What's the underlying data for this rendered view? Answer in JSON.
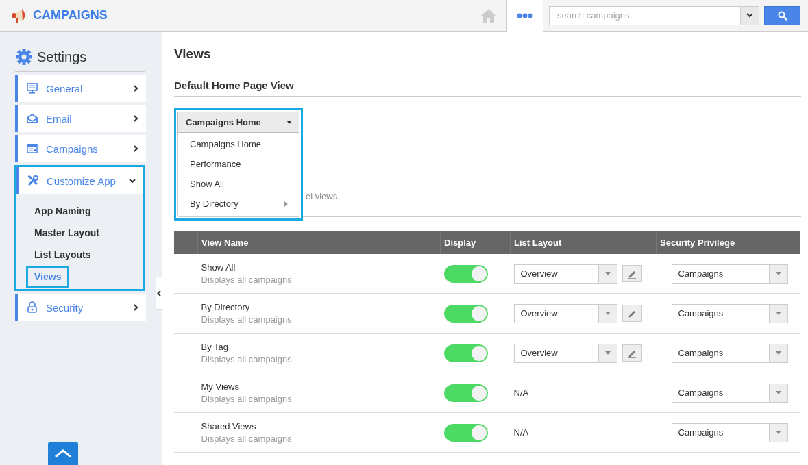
{
  "header": {
    "app_title": "CAMPAIGNS",
    "search": {
      "placeholder": "search campaigns"
    }
  },
  "sidebar": {
    "title": "Settings",
    "items": [
      {
        "label": "General",
        "expanded": false
      },
      {
        "label": "Email",
        "expanded": false
      },
      {
        "label": "Campaigns",
        "expanded": false
      },
      {
        "label": "Customize App",
        "expanded": true,
        "children": [
          {
            "label": "App Naming",
            "selected": false
          },
          {
            "label": "Master Layout",
            "selected": false
          },
          {
            "label": "List Layouts",
            "selected": false
          },
          {
            "label": "Views",
            "selected": true
          }
        ]
      },
      {
        "label": "Security",
        "expanded": false
      }
    ]
  },
  "main": {
    "title": "Views",
    "section_title": "Default Home Page View",
    "home_view_dropdown": {
      "value": "Campaigns Home",
      "open": true,
      "options": [
        {
          "label": "Campaigns Home",
          "has_submenu": false
        },
        {
          "label": "Performance",
          "has_submenu": false
        },
        {
          "label": "Show All",
          "has_submenu": false
        },
        {
          "label": "By Directory",
          "has_submenu": true
        }
      ]
    },
    "description_fragment": "el views.",
    "table": {
      "columns": [
        "View Name",
        "Display",
        "List Layout",
        "Security Privilege"
      ],
      "rows": [
        {
          "name": "Show All",
          "description": "Displays all campaigns",
          "display": true,
          "list_layout": {
            "kind": "select",
            "value": "Overview"
          },
          "security": "Campaigns"
        },
        {
          "name": "By Directory",
          "description": "Displays all campaigns",
          "display": true,
          "list_layout": {
            "kind": "select",
            "value": "Overview"
          },
          "security": "Campaigns"
        },
        {
          "name": "By Tag",
          "description": "Displays all campaigns",
          "display": true,
          "list_layout": {
            "kind": "select",
            "value": "Overview"
          },
          "security": "Campaigns"
        },
        {
          "name": "My Views",
          "description": "Displays all campaigns",
          "display": true,
          "list_layout": {
            "kind": "text",
            "value": "N/A"
          },
          "security": "Campaigns"
        },
        {
          "name": "Shared Views",
          "description": "Displays all campaigns",
          "display": true,
          "list_layout": {
            "kind": "text",
            "value": "N/A"
          },
          "security": "Campaigns"
        }
      ]
    }
  }
}
